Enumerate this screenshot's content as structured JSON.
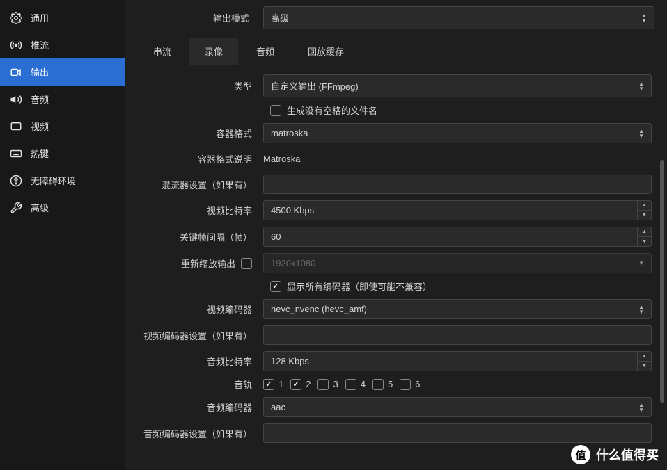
{
  "sidebar": {
    "items": [
      {
        "label": "通用",
        "icon": "gear"
      },
      {
        "label": "推流",
        "icon": "antenna"
      },
      {
        "label": "输出",
        "icon": "output",
        "active": true
      },
      {
        "label": "音频",
        "icon": "speaker"
      },
      {
        "label": "视频",
        "icon": "monitor"
      },
      {
        "label": "热键",
        "icon": "keyboard"
      },
      {
        "label": "无障碍环境",
        "icon": "accessibility"
      },
      {
        "label": "高级",
        "icon": "tools"
      }
    ]
  },
  "outputMode": {
    "label": "输出模式",
    "value": "高级"
  },
  "tabs": [
    {
      "label": "串流"
    },
    {
      "label": "录像",
      "active": true
    },
    {
      "label": "音频"
    },
    {
      "label": "回放缓存"
    }
  ],
  "fields": {
    "type": {
      "label": "类型",
      "value": "自定义输出 (FFmpeg)"
    },
    "noSpaces": {
      "label": "生成没有空格的文件名",
      "checked": false
    },
    "container": {
      "label": "容器格式",
      "value": "matroska"
    },
    "containerDesc": {
      "label": "容器格式说明",
      "value": "Matroska"
    },
    "muxer": {
      "label": "混流器设置（如果有）",
      "value": ""
    },
    "vbitrate": {
      "label": "视频比特率",
      "value": "4500 Kbps"
    },
    "keyint": {
      "label": "关键帧间隔（帧）",
      "value": "60"
    },
    "rescale": {
      "label": "重新缩放输出",
      "checked": false,
      "value": "1920x1080"
    },
    "showAll": {
      "label": "显示所有编码器（即使可能不兼容）",
      "checked": true
    },
    "vencoder": {
      "label": "视频编码器",
      "value": "hevc_nvenc (hevc_amf)"
    },
    "vencSettings": {
      "label": "视频编码器设置（如果有）",
      "value": ""
    },
    "abitrate": {
      "label": "音频比特率",
      "value": "128 Kbps"
    },
    "tracks": {
      "label": "音轨",
      "items": [
        "1",
        "2",
        "3",
        "4",
        "5",
        "6"
      ],
      "checked": [
        true,
        true,
        false,
        false,
        false,
        false
      ]
    },
    "aencoder": {
      "label": "音频编码器",
      "value": "aac"
    },
    "aencSettings": {
      "label": "音频编码器设置（如果有）",
      "value": ""
    }
  },
  "watermark": {
    "char": "值",
    "text": "什么值得买"
  }
}
